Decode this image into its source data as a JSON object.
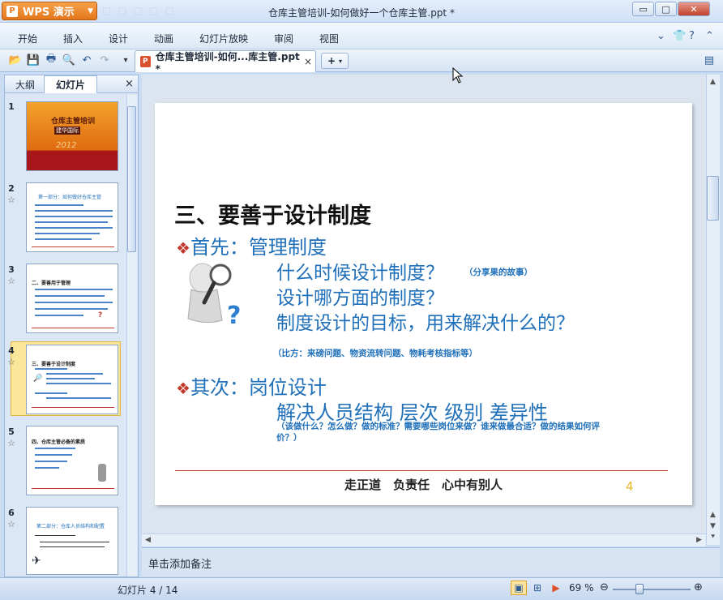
{
  "window": {
    "app_name": "WPS 演示",
    "app_logo": "P",
    "doc_title": "仓库主管培训-如何做好一个仓库主管.ppt *",
    "controls": [
      "▭",
      "□",
      "✕"
    ]
  },
  "menu": {
    "items": [
      "开始",
      "插入",
      "设计",
      "动画",
      "幻灯片放映",
      "审阅",
      "视图"
    ]
  },
  "doc_tab": {
    "label": "仓库主管培训-如何...库主管.ppt *",
    "close": "×",
    "new_tab": "+"
  },
  "left_pane": {
    "tab_outline": "大纲",
    "tab_slides": "幻灯片",
    "close": "×",
    "slides": [
      {
        "num": "1",
        "title": "仓库主管培训",
        "sub": "建华国际",
        "year": "2012"
      },
      {
        "num": "2",
        "title": "第一部分：如何做好仓库主管"
      },
      {
        "num": "3",
        "title": "二、要善用于管理"
      },
      {
        "num": "4",
        "title": "三、要善于设计制度"
      },
      {
        "num": "5",
        "title": "四、仓库主管必备的素质"
      },
      {
        "num": "6",
        "title": "第二部分：仓库人员结构和配置"
      }
    ],
    "star": "☆"
  },
  "slide": {
    "title": "三、要善于设计制度",
    "bullet": "❖",
    "first": "首先：管理制度",
    "line1": "什么时候设计制度？",
    "line1_note": "（分享果的故事）",
    "line2": "设计哪方面的制度？",
    "line3": "制度设计的目标，用来解决什么的？",
    "example": "（比方：来磅问题、物资流转问题、物耗考核指标等）",
    "second": "其次：岗位设计",
    "line4": "解决人员结构 层次 级别 差异性",
    "line4_note": "（该做什么？怎么做？做的标准？需要哪些岗位来做？谁来做最合适？做的结果如何评价？）",
    "footer": "走正道　负责任　心中有别人",
    "page_num": "4"
  },
  "notes": {
    "placeholder": "单击添加备注"
  },
  "status": {
    "slide_counter": "幻灯片 4 / 14",
    "zoom": "69 %",
    "zoom_level": 0.69
  },
  "colors": {
    "accent_blue": "#1f6fb9",
    "bullet_red": "#c0392b",
    "page_yellow": "#e9b929",
    "app_orange": "#e3761a"
  }
}
